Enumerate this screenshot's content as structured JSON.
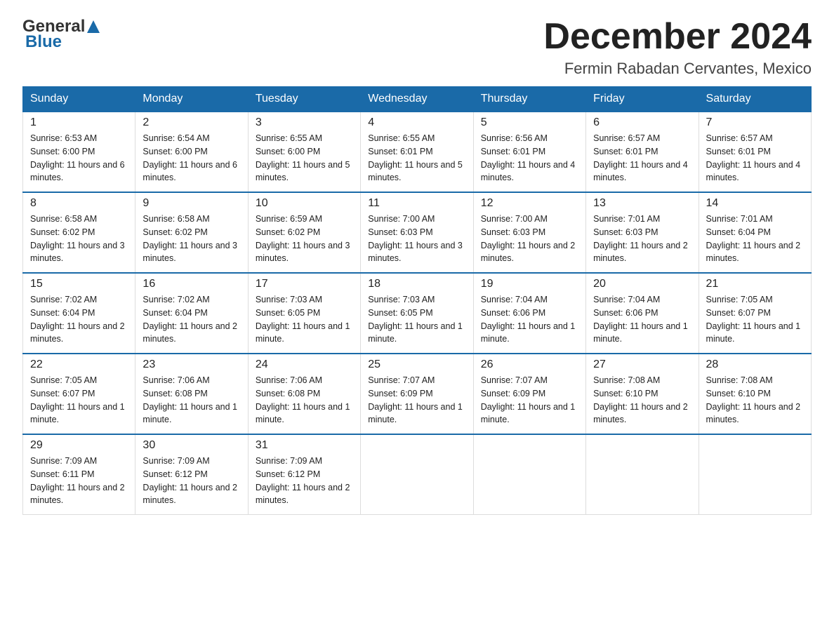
{
  "header": {
    "logo_general": "General",
    "logo_blue": "Blue",
    "month_title": "December 2024",
    "subtitle": "Fermin Rabadan Cervantes, Mexico"
  },
  "weekdays": [
    "Sunday",
    "Monday",
    "Tuesday",
    "Wednesday",
    "Thursday",
    "Friday",
    "Saturday"
  ],
  "weeks": [
    [
      {
        "day": "1",
        "sunrise": "Sunrise: 6:53 AM",
        "sunset": "Sunset: 6:00 PM",
        "daylight": "Daylight: 11 hours and 6 minutes."
      },
      {
        "day": "2",
        "sunrise": "Sunrise: 6:54 AM",
        "sunset": "Sunset: 6:00 PM",
        "daylight": "Daylight: 11 hours and 6 minutes."
      },
      {
        "day": "3",
        "sunrise": "Sunrise: 6:55 AM",
        "sunset": "Sunset: 6:00 PM",
        "daylight": "Daylight: 11 hours and 5 minutes."
      },
      {
        "day": "4",
        "sunrise": "Sunrise: 6:55 AM",
        "sunset": "Sunset: 6:01 PM",
        "daylight": "Daylight: 11 hours and 5 minutes."
      },
      {
        "day": "5",
        "sunrise": "Sunrise: 6:56 AM",
        "sunset": "Sunset: 6:01 PM",
        "daylight": "Daylight: 11 hours and 4 minutes."
      },
      {
        "day": "6",
        "sunrise": "Sunrise: 6:57 AM",
        "sunset": "Sunset: 6:01 PM",
        "daylight": "Daylight: 11 hours and 4 minutes."
      },
      {
        "day": "7",
        "sunrise": "Sunrise: 6:57 AM",
        "sunset": "Sunset: 6:01 PM",
        "daylight": "Daylight: 11 hours and 4 minutes."
      }
    ],
    [
      {
        "day": "8",
        "sunrise": "Sunrise: 6:58 AM",
        "sunset": "Sunset: 6:02 PM",
        "daylight": "Daylight: 11 hours and 3 minutes."
      },
      {
        "day": "9",
        "sunrise": "Sunrise: 6:58 AM",
        "sunset": "Sunset: 6:02 PM",
        "daylight": "Daylight: 11 hours and 3 minutes."
      },
      {
        "day": "10",
        "sunrise": "Sunrise: 6:59 AM",
        "sunset": "Sunset: 6:02 PM",
        "daylight": "Daylight: 11 hours and 3 minutes."
      },
      {
        "day": "11",
        "sunrise": "Sunrise: 7:00 AM",
        "sunset": "Sunset: 6:03 PM",
        "daylight": "Daylight: 11 hours and 3 minutes."
      },
      {
        "day": "12",
        "sunrise": "Sunrise: 7:00 AM",
        "sunset": "Sunset: 6:03 PM",
        "daylight": "Daylight: 11 hours and 2 minutes."
      },
      {
        "day": "13",
        "sunrise": "Sunrise: 7:01 AM",
        "sunset": "Sunset: 6:03 PM",
        "daylight": "Daylight: 11 hours and 2 minutes."
      },
      {
        "day": "14",
        "sunrise": "Sunrise: 7:01 AM",
        "sunset": "Sunset: 6:04 PM",
        "daylight": "Daylight: 11 hours and 2 minutes."
      }
    ],
    [
      {
        "day": "15",
        "sunrise": "Sunrise: 7:02 AM",
        "sunset": "Sunset: 6:04 PM",
        "daylight": "Daylight: 11 hours and 2 minutes."
      },
      {
        "day": "16",
        "sunrise": "Sunrise: 7:02 AM",
        "sunset": "Sunset: 6:04 PM",
        "daylight": "Daylight: 11 hours and 2 minutes."
      },
      {
        "day": "17",
        "sunrise": "Sunrise: 7:03 AM",
        "sunset": "Sunset: 6:05 PM",
        "daylight": "Daylight: 11 hours and 1 minute."
      },
      {
        "day": "18",
        "sunrise": "Sunrise: 7:03 AM",
        "sunset": "Sunset: 6:05 PM",
        "daylight": "Daylight: 11 hours and 1 minute."
      },
      {
        "day": "19",
        "sunrise": "Sunrise: 7:04 AM",
        "sunset": "Sunset: 6:06 PM",
        "daylight": "Daylight: 11 hours and 1 minute."
      },
      {
        "day": "20",
        "sunrise": "Sunrise: 7:04 AM",
        "sunset": "Sunset: 6:06 PM",
        "daylight": "Daylight: 11 hours and 1 minute."
      },
      {
        "day": "21",
        "sunrise": "Sunrise: 7:05 AM",
        "sunset": "Sunset: 6:07 PM",
        "daylight": "Daylight: 11 hours and 1 minute."
      }
    ],
    [
      {
        "day": "22",
        "sunrise": "Sunrise: 7:05 AM",
        "sunset": "Sunset: 6:07 PM",
        "daylight": "Daylight: 11 hours and 1 minute."
      },
      {
        "day": "23",
        "sunrise": "Sunrise: 7:06 AM",
        "sunset": "Sunset: 6:08 PM",
        "daylight": "Daylight: 11 hours and 1 minute."
      },
      {
        "day": "24",
        "sunrise": "Sunrise: 7:06 AM",
        "sunset": "Sunset: 6:08 PM",
        "daylight": "Daylight: 11 hours and 1 minute."
      },
      {
        "day": "25",
        "sunrise": "Sunrise: 7:07 AM",
        "sunset": "Sunset: 6:09 PM",
        "daylight": "Daylight: 11 hours and 1 minute."
      },
      {
        "day": "26",
        "sunrise": "Sunrise: 7:07 AM",
        "sunset": "Sunset: 6:09 PM",
        "daylight": "Daylight: 11 hours and 1 minute."
      },
      {
        "day": "27",
        "sunrise": "Sunrise: 7:08 AM",
        "sunset": "Sunset: 6:10 PM",
        "daylight": "Daylight: 11 hours and 2 minutes."
      },
      {
        "day": "28",
        "sunrise": "Sunrise: 7:08 AM",
        "sunset": "Sunset: 6:10 PM",
        "daylight": "Daylight: 11 hours and 2 minutes."
      }
    ],
    [
      {
        "day": "29",
        "sunrise": "Sunrise: 7:09 AM",
        "sunset": "Sunset: 6:11 PM",
        "daylight": "Daylight: 11 hours and 2 minutes."
      },
      {
        "day": "30",
        "sunrise": "Sunrise: 7:09 AM",
        "sunset": "Sunset: 6:12 PM",
        "daylight": "Daylight: 11 hours and 2 minutes."
      },
      {
        "day": "31",
        "sunrise": "Sunrise: 7:09 AM",
        "sunset": "Sunset: 6:12 PM",
        "daylight": "Daylight: 11 hours and 2 minutes."
      },
      null,
      null,
      null,
      null
    ]
  ]
}
